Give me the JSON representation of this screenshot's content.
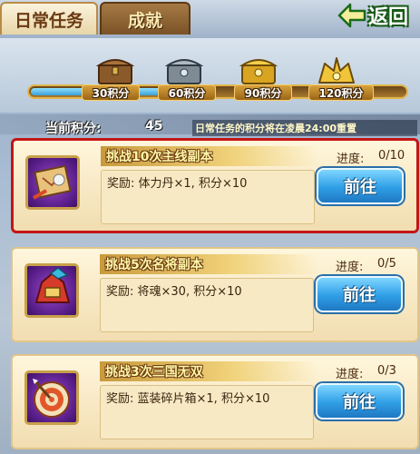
{
  "tabs": {
    "daily": "日常任务",
    "achievements": "成就"
  },
  "back_label": "返回",
  "rewards": {
    "progress_fraction": 0.375,
    "milestones": [
      {
        "label": "30积分",
        "chest": "wooden-chest-icon"
      },
      {
        "label": "60积分",
        "chest": "silver-chest-icon"
      },
      {
        "label": "90积分",
        "chest": "gold-chest-icon"
      },
      {
        "label": "120积分",
        "chest": "golden-treasure-icon"
      }
    ]
  },
  "score": {
    "label": "当前积分:",
    "value": "45",
    "note": "日常任务的积分将在凌晨24:00重置"
  },
  "tasks": [
    {
      "title": "挑战10次主线副本",
      "progress_label": "进度:",
      "progress_value": "0/10",
      "reward_text": "奖励: 体力丹×1, 积分×10",
      "button_label": "前往",
      "icon": "map-scroll-icon",
      "selected": true
    },
    {
      "title": "挑战5次名将副本",
      "progress_label": "进度:",
      "progress_value": "0/5",
      "reward_text": "奖励: 将魂×30, 积分×10",
      "button_label": "前往",
      "icon": "general-helmet-icon",
      "selected": false
    },
    {
      "title": "挑战3次三国无双",
      "progress_label": "进度:",
      "progress_value": "0/3",
      "reward_text": "奖励: 蓝装碎片箱×1, 积分×10",
      "button_label": "前往",
      "icon": "target-arrow-icon",
      "selected": false
    }
  ]
}
